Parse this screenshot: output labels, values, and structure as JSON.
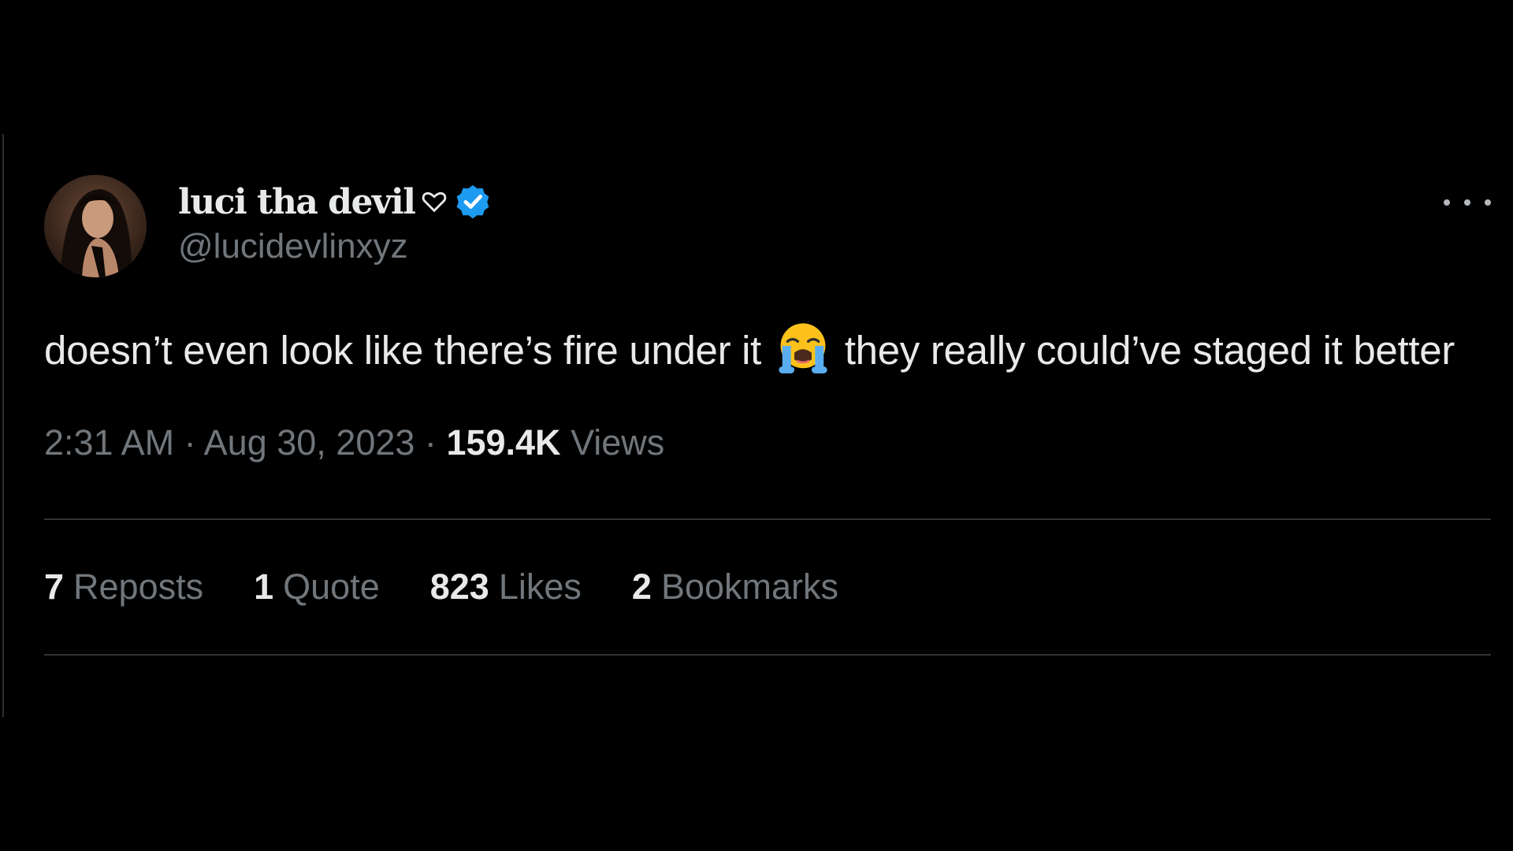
{
  "tweet": {
    "display_name": "luci tha devil",
    "handle": "@lucidevlinxyz",
    "text_before_emoji": "doesn’t even look like there’s fire under it",
    "text_after_emoji": "they really could’ve staged it better",
    "emoji_icon": "loudly-crying-face-icon",
    "time": "2:31 AM",
    "separator": "·",
    "date": "Aug 30, 2023",
    "views_count": "159.4K",
    "views_label": "Views"
  },
  "stats": [
    {
      "count": "7",
      "label": "Reposts"
    },
    {
      "count": "1",
      "label": "Quote"
    },
    {
      "count": "823",
      "label": "Likes"
    },
    {
      "count": "2",
      "label": "Bookmarks"
    }
  ],
  "icons": {
    "heart": "heart-outline-icon",
    "verified": "verified-badge-icon",
    "more": "more-options-icon"
  },
  "colors": {
    "background": "#000000",
    "primary_text": "#e7e9ea",
    "secondary_text": "#71767b",
    "verified_blue": "#1d9bf0",
    "divider": "#2f3336"
  }
}
